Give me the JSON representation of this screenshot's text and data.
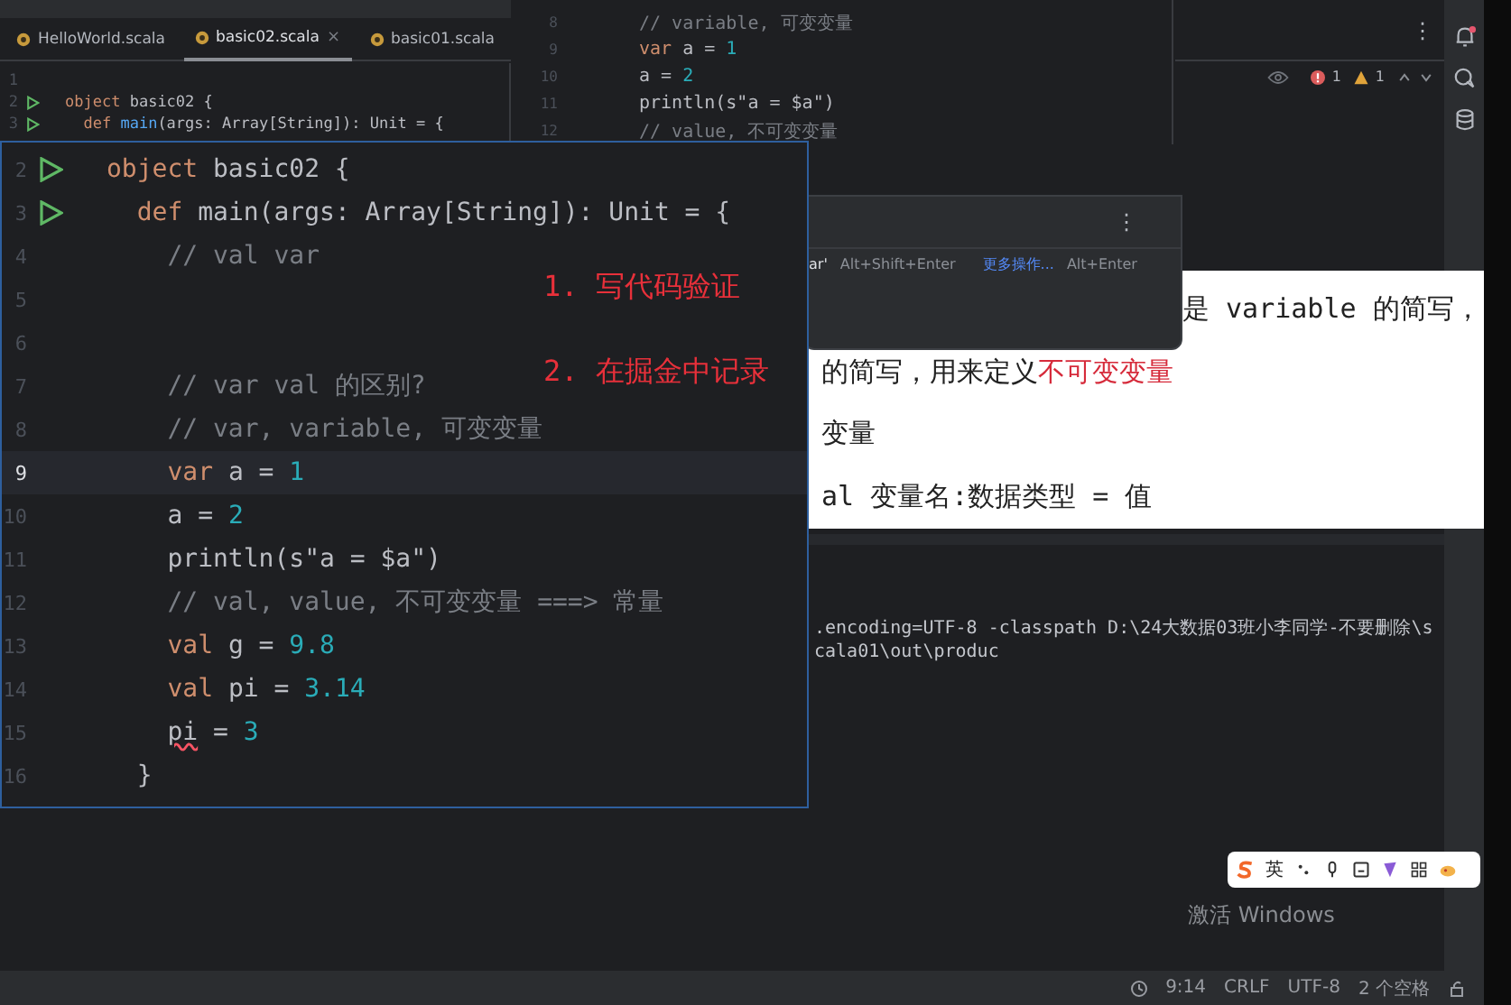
{
  "editor_tabs": [
    {
      "label": "HelloWorld.scala",
      "selected": false
    },
    {
      "label": "basic02.scala",
      "selected": true,
      "close": "×"
    },
    {
      "label": "basic01.scala",
      "selected": false
    }
  ],
  "left_editor": {
    "lines": [
      {
        "number": "1",
        "run": false
      },
      {
        "number": "2",
        "run": true,
        "tokens": [
          {
            "text": "object",
            "kind": "keyword"
          },
          {
            "text": " basic02 {",
            "kind": "plain"
          }
        ]
      },
      {
        "number": "3",
        "run": true,
        "tokens": [
          {
            "text": "  def",
            "kind": "keyword"
          },
          {
            "text": " main",
            "kind": "func"
          },
          {
            "text": "(args: Array[String]): Unit = {",
            "kind": "plain"
          }
        ]
      }
    ]
  },
  "right_editor": {
    "lines": [
      {
        "number": "8",
        "tokens": [
          {
            "text": "// variable, 可变变量",
            "kind": "comment"
          }
        ]
      },
      {
        "number": "9",
        "tokens": [
          {
            "text": "var",
            "kind": "keyword"
          },
          {
            "text": " a = ",
            "kind": "plain"
          },
          {
            "text": "1",
            "kind": "number"
          }
        ]
      },
      {
        "number": "10",
        "tokens": [
          {
            "text": "a = ",
            "kind": "plain"
          },
          {
            "text": "2",
            "kind": "number"
          }
        ]
      },
      {
        "number": "11",
        "tokens": [
          {
            "text": "println(s\"a = $a\")",
            "kind": "plain"
          }
        ]
      },
      {
        "number": "12",
        "tokens": [
          {
            "text": "// value, 不可变变量",
            "kind": "comment"
          }
        ]
      }
    ]
  },
  "side_panel": {
    "menu": "⋮",
    "errors": "1",
    "warnings": "1"
  },
  "intention_popup": {
    "menu": "⋮",
    "actions": [
      {
        "label": "ar'",
        "shortcut": "Alt+Shift+Enter",
        "kind": "plain"
      },
      {
        "label": "更多操作...",
        "shortcut": "Alt+Enter",
        "kind": "link"
      }
    ]
  },
  "document": {
    "lines": [
      {
        "segments": [
          {
            "text": "是 variable 的简写，",
            "kind": "plain"
          }
        ]
      },
      {
        "segments": [
          {
            "text": "的简写，用来定义",
            "kind": "plain"
          },
          {
            "text": "不可变变量",
            "kind": "highlight"
          }
        ]
      },
      {
        "segments": [
          {
            "text": "变量",
            "kind": "plain"
          }
        ]
      },
      {
        "segments": [
          {
            "text": "al 变量名:数据类型 = 值",
            "kind": "plain"
          }
        ]
      }
    ]
  },
  "console": {
    "lines": [
      ".encoding=UTF-8 -classpath D:\\24大数据03班小李同学-不要删除\\scala01\\out\\produc"
    ]
  },
  "zoom_panel": {
    "lines": [
      {
        "number": "2",
        "run": true,
        "current": false,
        "tokens": [
          {
            "text": "object",
            "kind": "keyword"
          },
          {
            "text": " basic02 {",
            "kind": "plain"
          }
        ]
      },
      {
        "number": "3",
        "run": true,
        "current": false,
        "tokens": [
          {
            "text": "  def",
            "kind": "keyword"
          },
          {
            "text": " main(args: Array[String]): Unit = {",
            "kind": "plain"
          }
        ]
      },
      {
        "number": "4",
        "run": false,
        "current": false,
        "tokens": [
          {
            "text": "    // val var",
            "kind": "comment"
          }
        ]
      },
      {
        "number": "5",
        "run": false,
        "current": false
      },
      {
        "number": "6",
        "run": false,
        "current": false
      },
      {
        "number": "7",
        "run": false,
        "current": false,
        "tokens": [
          {
            "text": "    // var val 的区别?",
            "kind": "comment"
          }
        ]
      },
      {
        "number": "8",
        "run": false,
        "current": false,
        "tokens": [
          {
            "text": "    // var, variable, 可变变量",
            "kind": "comment"
          }
        ]
      },
      {
        "number": "9",
        "run": false,
        "current": true,
        "tokens": [
          {
            "text": "    var",
            "kind": "keyword"
          },
          {
            "text": " a = ",
            "kind": "plain"
          },
          {
            "text": "1",
            "kind": "number"
          }
        ]
      },
      {
        "number": "10",
        "run": false,
        "current": false,
        "tokens": [
          {
            "text": "    a = ",
            "kind": "plain"
          },
          {
            "text": "2",
            "kind": "number"
          }
        ]
      },
      {
        "number": "11",
        "run": false,
        "current": false,
        "tokens": [
          {
            "text": "    println(s\"a = $a\")",
            "kind": "plain"
          }
        ]
      },
      {
        "number": "12",
        "run": false,
        "current": false,
        "tokens": [
          {
            "text": "    // val, value, 不可变变量 ===> 常量",
            "kind": "comment"
          }
        ]
      },
      {
        "number": "13",
        "run": false,
        "current": false,
        "tokens": [
          {
            "text": "    val",
            "kind": "keyword"
          },
          {
            "text": " g = ",
            "kind": "plain"
          },
          {
            "text": "9.8",
            "kind": "number"
          }
        ]
      },
      {
        "number": "14",
        "run": false,
        "current": false,
        "tokens": [
          {
            "text": "    val",
            "kind": "keyword"
          },
          {
            "text": " pi = ",
            "kind": "plain"
          },
          {
            "text": "3.14",
            "kind": "number"
          }
        ]
      },
      {
        "number": "15",
        "run": false,
        "current": false,
        "tokens": [
          {
            "text": "    pi",
            "kind": "error"
          },
          {
            "text": " = ",
            "kind": "plain"
          },
          {
            "text": "3",
            "kind": "number"
          }
        ]
      },
      {
        "number": "16",
        "run": false,
        "current": false,
        "tokens": [
          {
            "text": "  }",
            "kind": "plain"
          }
        ]
      }
    ],
    "annotations": [
      "1. 写代码验证",
      "2. 在掘金中记录"
    ]
  },
  "ime_toolbar": {
    "label": "英"
  },
  "os_notice": "激活 Windows",
  "status_bar": {
    "position": "9:14",
    "line_separator": "CRLF",
    "encoding": "UTF-8",
    "indent": "2 个空格"
  }
}
